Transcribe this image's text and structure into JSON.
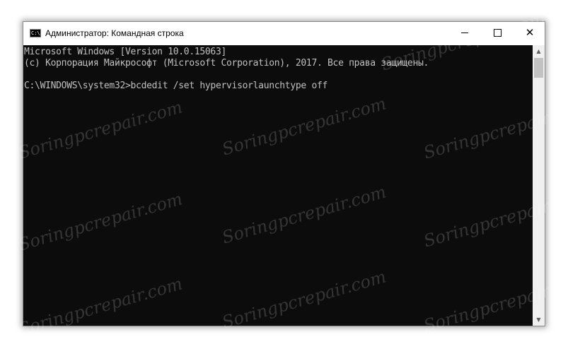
{
  "window": {
    "title": "Администратор: Командная строка",
    "icon_label": "C:\\"
  },
  "controls": {
    "minimize_icon": "minimize-icon",
    "maximize_icon": "maximize-icon",
    "close_icon": "close-icon",
    "close_glyph": "✕"
  },
  "console": {
    "lines": [
      "Microsoft Windows [Version 10.0.15063]",
      "(c) Корпорация Майкрософт (Microsoft Corporation), 2017. Все права защищены.",
      "",
      "C:\\WINDOWS\\system32>bcdedit /set hypervisorlaunchtype off"
    ]
  },
  "scrollbar": {
    "up_glyph": "▲",
    "down_glyph": "▼"
  },
  "watermark": {
    "text": "Soringpcrepair.com"
  },
  "colors": {
    "console_bg": "#0c0c0c",
    "console_text": "#c0c0c0",
    "titlebar_bg": "#ffffff"
  }
}
